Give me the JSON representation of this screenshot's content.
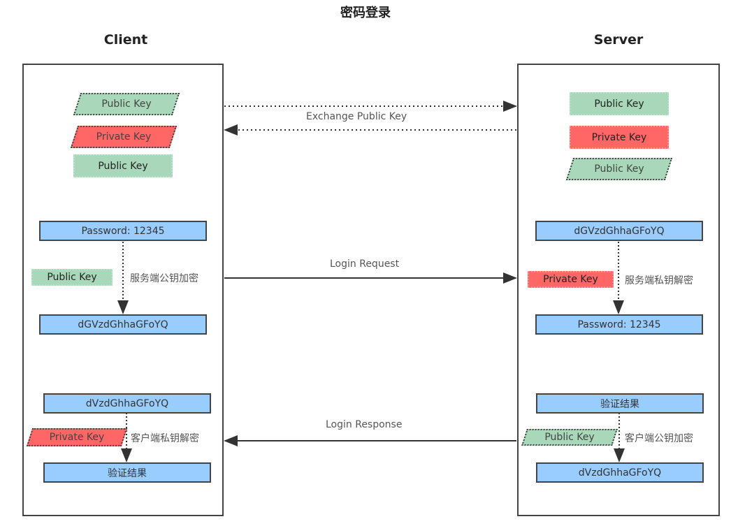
{
  "title": "密码登录",
  "client": {
    "heading": "Client",
    "keys": {
      "received_public_key": "Public Key",
      "private_key": "Private Key",
      "public_key": "Public Key"
    },
    "login": {
      "password_box": "Password: 12345",
      "key_used": "Public Key",
      "action_label": "服务端公钥加密",
      "encrypted_box": "dGVzdGhhaGFoYQ"
    },
    "response": {
      "encrypted_box": "dVzdGhhaGFoYQ",
      "key_used": "Private Key",
      "action_label": "客户端私钥解密",
      "result_box": "验证结果"
    }
  },
  "server": {
    "heading": "Server",
    "keys": {
      "public_key": "Public Key",
      "private_key": "Private Key",
      "received_public_key": "Public Key"
    },
    "login": {
      "encrypted_box": "dGVzdGhhaGFoYQ",
      "key_used": "Private Key",
      "action_label": "服务端私钥解密",
      "decrypted_box": "Password: 12345"
    },
    "response": {
      "result_box": "验证结果",
      "key_used": "Public Key",
      "action_label": "客户端公钥加密",
      "encrypted_box": "dVzdGhhaGFoYQ"
    }
  },
  "messages": {
    "exchange": "Exchange Public Key",
    "login_request": "Login Request",
    "login_response": "Login Response"
  },
  "colors": {
    "public_key": "#a8d8b9",
    "private_key": "#ff6666",
    "data_box": "#99ccff",
    "border": "#444444"
  }
}
